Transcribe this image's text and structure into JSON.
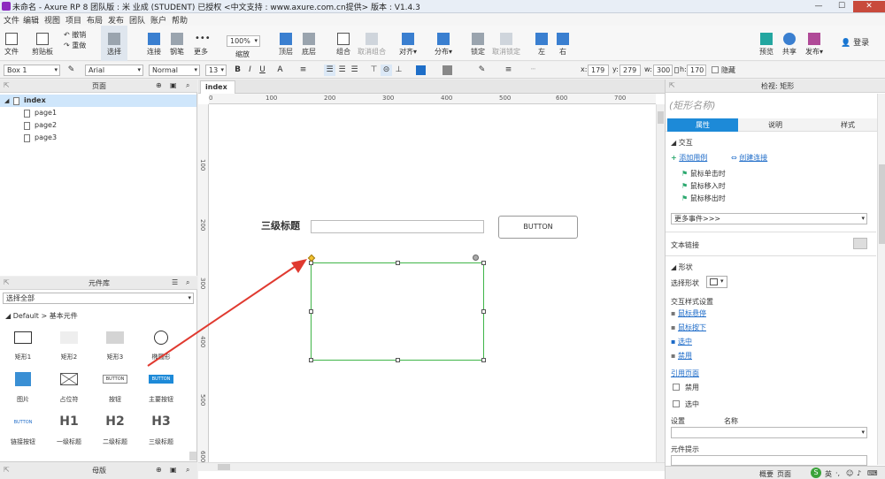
{
  "window": {
    "title": "未命名 - Axure RP 8 团队版 : 米 业成 (STUDENT) 已授权     <中文支持 : www.axure.com.cn提供> 版本 : V1.4.3",
    "minimize": "—",
    "maximize": "☐",
    "close": "✕"
  },
  "menu": [
    "文件",
    "编辑",
    "视图",
    "项目",
    "布局",
    "发布",
    "团队",
    "账户",
    "帮助"
  ],
  "toolbar": {
    "file": "文件",
    "clipboard": "剪贴板",
    "undo": "撤销",
    "redo": "重做",
    "select": "选择",
    "connect": "连接",
    "pen": "钢笔",
    "more": "更多",
    "zoom_value": "100%",
    "zoom": "缩放",
    "top": "顶层",
    "bottom": "底层",
    "group": "组合",
    "ungroup": "取消组合",
    "align": "对齐",
    "distribute": "分布",
    "lock": "锁定",
    "unlock": "取消锁定",
    "left": "左",
    "right": "右",
    "preview": "预览",
    "share": "共享",
    "publish": "发布",
    "login": "登录"
  },
  "format": {
    "widget_name": "Box 1",
    "font": "Arial",
    "style": "Normal",
    "size": "13",
    "bold": "B",
    "italic": "I",
    "underline": "U",
    "x_label": "x:",
    "x": "179",
    "y_label": "y:",
    "y": "279",
    "w_label": "w:",
    "w": "300",
    "h_label": "h:",
    "h": "170",
    "hide_label": "隐藏"
  },
  "pages_panel": {
    "title": "页面",
    "items": [
      "index",
      "page1",
      "page2",
      "page3"
    ]
  },
  "library_panel": {
    "title": "元件库",
    "filter": "选择全部",
    "group": "Default > 基本元件",
    "widgets": [
      {
        "label": "矩形1"
      },
      {
        "label": "矩形2"
      },
      {
        "label": "矩形3"
      },
      {
        "label": "椭圆形"
      },
      {
        "label": "图片"
      },
      {
        "label": "占位符"
      },
      {
        "label": "按钮",
        "text": "BUTTON"
      },
      {
        "label": "主要按钮",
        "text": "BUTTON"
      },
      {
        "label": "链接按钮",
        "text": "BUTTON"
      },
      {
        "label": "一级标题",
        "text": "H1"
      },
      {
        "label": "二级标题",
        "text": "H2"
      },
      {
        "label": "三级标题",
        "text": "H3"
      }
    ]
  },
  "master_panel": {
    "title": "母版"
  },
  "canvas": {
    "tab": "index",
    "ruler_top": [
      "0",
      "100",
      "200",
      "300",
      "400",
      "500",
      "600",
      "700"
    ],
    "ruler_left": [
      "100",
      "200",
      "300",
      "400",
      "500",
      "600"
    ],
    "heading": "三级标题",
    "button": "BUTTON"
  },
  "inspector": {
    "title": "检视: 矩形",
    "name_placeholder": "(矩形名称)",
    "tabs": [
      "属性",
      "说明",
      "样式"
    ],
    "interaction_header": "交互",
    "add_case": "添加用例",
    "create_link": "创建连接",
    "events": [
      "鼠标单击时",
      "鼠标移入时",
      "鼠标移出时"
    ],
    "more_events": "更多事件>>>",
    "text_link": "文本链接",
    "shape_header": "形状",
    "select_shape": "选择形状",
    "interaction_styles": "交互样式设置",
    "style_links": [
      "鼠标悬停",
      "鼠标按下",
      "选中",
      "禁用"
    ],
    "ref_page": "引用页面",
    "disabled": "禁用",
    "selected": "选中",
    "set_group": "设置",
    "set_group_tail": "名称",
    "tooltip": "元件提示",
    "bottom_tabs": [
      "概要",
      "页面"
    ]
  },
  "colors": {
    "accent": "#3a9ad9",
    "selection": "#3fb548",
    "arrow": "#e03a30"
  }
}
